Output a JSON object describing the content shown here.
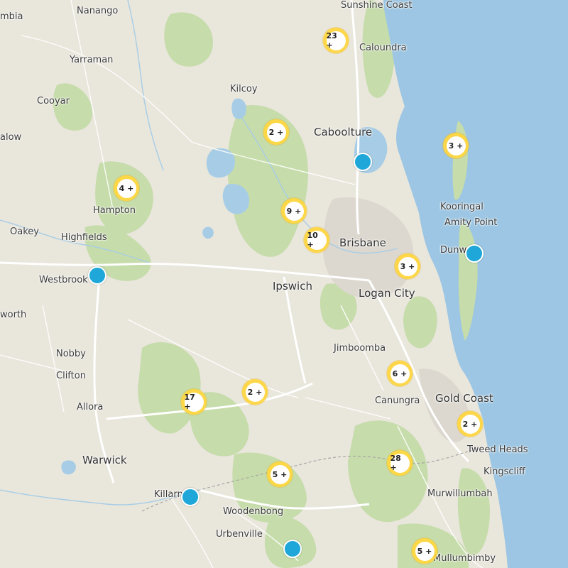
{
  "places": [
    {
      "id": "sunshine-coast",
      "label": "Sunshine Coast"
    },
    {
      "id": "nanango",
      "label": "Nanango"
    },
    {
      "id": "mbia",
      "label": "mbia"
    },
    {
      "id": "caloundra",
      "label": "Caloundra"
    },
    {
      "id": "yarraman",
      "label": "Yarraman"
    },
    {
      "id": "kilcoy",
      "label": "Kilcoy"
    },
    {
      "id": "cooyar",
      "label": "Cooyar"
    },
    {
      "id": "caboolture",
      "label": "Caboolture"
    },
    {
      "id": "alow",
      "label": "alow"
    },
    {
      "id": "hampton",
      "label": "Hampton"
    },
    {
      "id": "kooringal",
      "label": "Kooringal"
    },
    {
      "id": "amity-point",
      "label": "Amity Point"
    },
    {
      "id": "oakey",
      "label": "Oakey"
    },
    {
      "id": "highfields",
      "label": "Highfields"
    },
    {
      "id": "brisbane",
      "label": "Brisbane"
    },
    {
      "id": "dunw",
      "label": "Dunw"
    },
    {
      "id": "westbrook",
      "label": "Westbrook"
    },
    {
      "id": "ipswich",
      "label": "Ipswich"
    },
    {
      "id": "logan-city",
      "label": "Logan City"
    },
    {
      "id": "worth",
      "label": "worth"
    },
    {
      "id": "jimboomba",
      "label": "Jimboomba"
    },
    {
      "id": "nobby",
      "label": "Nobby"
    },
    {
      "id": "clifton",
      "label": "Clifton"
    },
    {
      "id": "canungra",
      "label": "Canungra"
    },
    {
      "id": "gold-coast",
      "label": "Gold Coast"
    },
    {
      "id": "allora",
      "label": "Allora"
    },
    {
      "id": "tweed-heads",
      "label": "Tweed Heads"
    },
    {
      "id": "warwick",
      "label": "Warwick"
    },
    {
      "id": "kingscliff",
      "label": "Kingscliff"
    },
    {
      "id": "murwillumbah",
      "label": "Murwillumbah"
    },
    {
      "id": "killarney",
      "label": "Killarn"
    },
    {
      "id": "woodenbong",
      "label": "Woodenbong"
    },
    {
      "id": "urbenville",
      "label": "Urbenville"
    },
    {
      "id": "mullumbimby",
      "label": "Mullumbimby"
    }
  ],
  "clusters": [
    {
      "label": "23 +",
      "count": 23
    },
    {
      "label": "2 +",
      "count": 2
    },
    {
      "label": "3 +",
      "count": 3
    },
    {
      "label": "4 +",
      "count": 4
    },
    {
      "label": "9 +",
      "count": 9
    },
    {
      "label": "10 +",
      "count": 10
    },
    {
      "label": "3 +",
      "count": 3
    },
    {
      "label": "6 +",
      "count": 6
    },
    {
      "label": "2 +",
      "count": 2
    },
    {
      "label": "17 +",
      "count": 17
    },
    {
      "label": "2 +",
      "count": 2
    },
    {
      "label": "28 +",
      "count": 28
    },
    {
      "label": "5 +",
      "count": 5
    },
    {
      "label": "5 +",
      "count": 5
    }
  ],
  "markers": [
    {
      "name": "marker-caboolture"
    },
    {
      "name": "marker-dunwich"
    },
    {
      "name": "marker-westbrook"
    },
    {
      "name": "marker-killarney"
    },
    {
      "name": "marker-urbenville"
    }
  ],
  "colors": {
    "land": "#e9e6dc",
    "park": "#c6dcaa",
    "water": "#a7cde6",
    "ocean": "#9cc6e3",
    "cluster": "#ffd640",
    "marker": "#1ea7d8"
  }
}
